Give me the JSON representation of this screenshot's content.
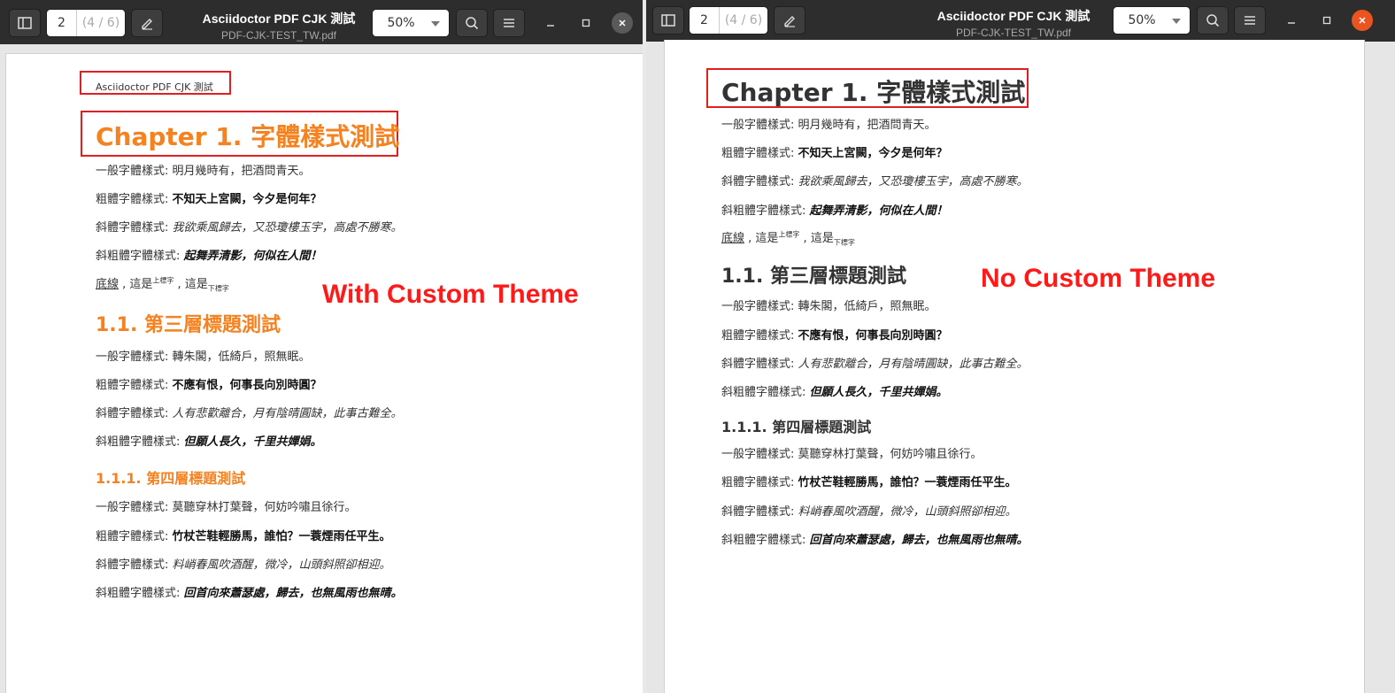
{
  "left": {
    "page_number": "2",
    "page_total": "(4 / 6)",
    "title": "Asciidoctor PDF CJK 測試",
    "subtitle": "PDF-CJK-TEST_TW.pdf",
    "zoom": "50%",
    "running_header": "Asciidoctor PDF CJK 測試",
    "annotation": "With Custom Theme",
    "heading_color": "#f58220"
  },
  "right": {
    "page_number": "2",
    "page_total": "(4 / 6)",
    "title": "Asciidoctor PDF CJK 測試",
    "subtitle": "PDF-CJK-TEST_TW.pdf",
    "zoom": "50%",
    "annotation": "No Custom Theme",
    "heading_color": "#333333"
  },
  "doc": {
    "chapter": "Chapter 1. 字體樣式測試",
    "p1_label": "一般字體樣式: ",
    "p1_text": "明月幾時有，把酒問青天。",
    "p2_label": "粗體字體樣式: ",
    "p2_text": "不知天上宮闕，今夕是何年？",
    "p3_label": "斜體字體樣式: ",
    "p3_text": "我欲乘風歸去，又恐瓊樓玉宇，高處不勝寒。",
    "p4_label": "斜粗體字體樣式: ",
    "p4_text": "起舞弄清影，何似在人間！",
    "underline": "底線",
    "sep1": " , 這是",
    "sup": "上標字",
    "sep2": " , 這是",
    "sub": "下標字",
    "h2": "1.1. 第三層標題測試",
    "q1_label": "一般字體樣式: ",
    "q1_text": "轉朱閣，低綺戶，照無眠。",
    "q2_label": "粗體字體樣式: ",
    "q2_text": "不應有恨，何事長向別時圓？",
    "q3_label": "斜體字體樣式: ",
    "q3_text": "人有悲歡離合，月有陰晴圓缺，此事古難全。",
    "q4_label": "斜粗體字體樣式: ",
    "q4_text": "但願人長久，千里共嬋娟。",
    "h3": "1.1.1. 第四層標題測試",
    "r1_label": "一般字體樣式: ",
    "r1_text": "莫聽穿林打葉聲，何妨吟嘯且徐行。",
    "r2_label": "粗體字體樣式: ",
    "r2_text": "竹杖芒鞋輕勝馬，誰怕？一蓑煙雨任平生。",
    "r3_label": "斜體字體樣式: ",
    "r3_text": "料峭春風吹酒醒，微冷，山頭斜照卻相迎。",
    "r4_label": "斜粗體字體樣式: ",
    "r4_text": "回首向來蕭瑟處，歸去，也無風雨也無晴。"
  }
}
